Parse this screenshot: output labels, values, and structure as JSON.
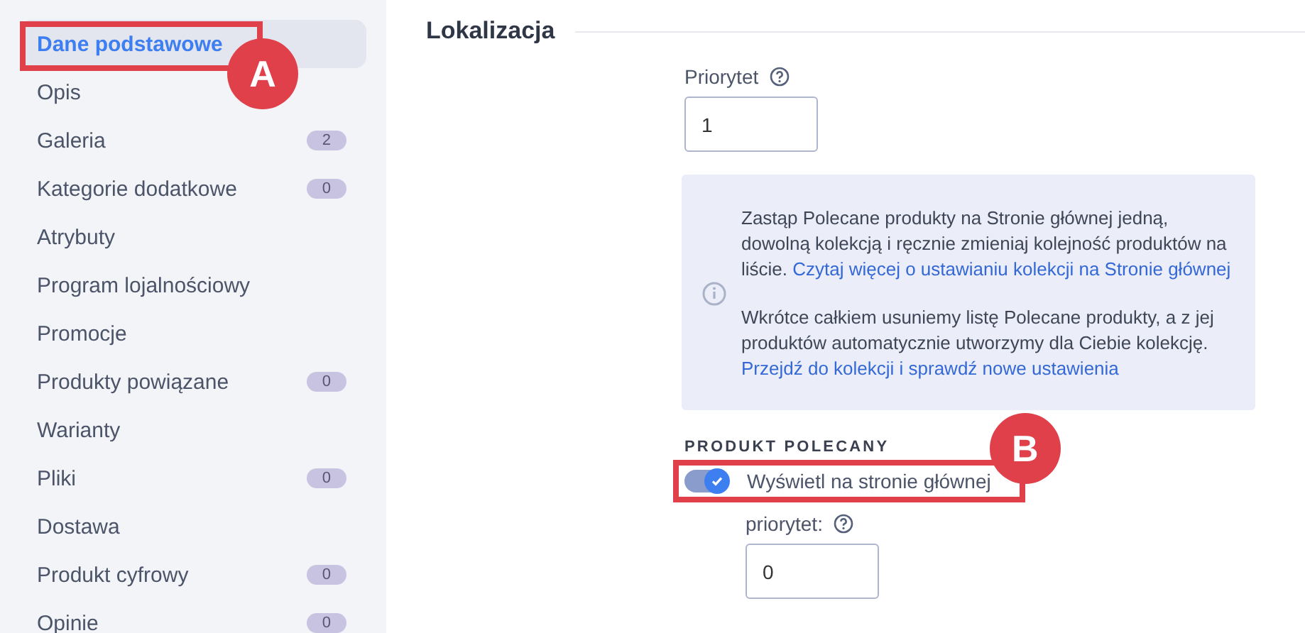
{
  "sidebar": {
    "items": [
      {
        "label": "Dane podstawowe",
        "selected": true
      },
      {
        "label": "Opis",
        "selected": false
      },
      {
        "label": "Galeria",
        "selected": false,
        "count": "2"
      },
      {
        "label": "Kategorie dodatkowe",
        "selected": false,
        "count": "0"
      },
      {
        "label": "Atrybuty",
        "selected": false
      },
      {
        "label": "Program lojalnościowy",
        "selected": false
      },
      {
        "label": "Promocje",
        "selected": false
      },
      {
        "label": "Produkty powiązane",
        "selected": false,
        "count": "0"
      },
      {
        "label": "Warianty",
        "selected": false
      },
      {
        "label": "Pliki",
        "selected": false,
        "count": "0"
      },
      {
        "label": "Dostawa",
        "selected": false
      },
      {
        "label": "Produkt cyfrowy",
        "selected": false,
        "count": "0"
      },
      {
        "label": "Opinie",
        "selected": false,
        "count": "0"
      }
    ]
  },
  "section": {
    "title": "Lokalizacja"
  },
  "priority": {
    "label": "Priorytet",
    "value": "1"
  },
  "info": {
    "paragraphs": [
      {
        "text": "Zastąp Polecane produkty na Stronie głównej jedną, dowolną kolekcją i ręcznie zmieniaj kolejność produktów na liście. ",
        "link": "Czytaj więcej o ustawianiu kolekcji na Stronie głównej"
      },
      {
        "text": "Wkrótce całkiem usuniemy listę Polecane produkty, a z jej produktów automatycznie utworzymy dla Ciebie kolekcję. ",
        "link": "Przejdź do kolekcji i sprawdź nowe ustawienia"
      }
    ]
  },
  "featured": {
    "heading": "PRODUKT POLECANY",
    "toggle": {
      "label": "Wyświetl na stronie głównej",
      "on": true
    },
    "priority_label": "priorytet:",
    "priority_value": "0"
  },
  "annotations": [
    "A",
    "B"
  ]
}
